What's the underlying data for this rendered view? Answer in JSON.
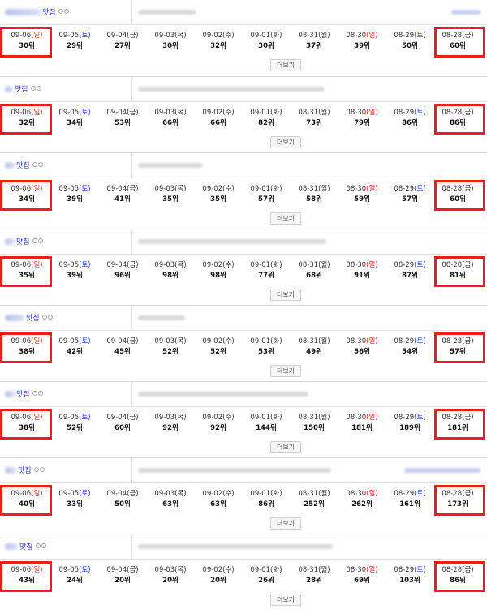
{
  "more_label": "더보기",
  "category_label": "맛집",
  "blocks": [
    {
      "ranks": [
        "30위",
        "29위",
        "27위",
        "30위",
        "32위",
        "30위",
        "37위",
        "39위",
        "50위",
        "60위"
      ]
    },
    {
      "ranks": [
        "32위",
        "34위",
        "53위",
        "66위",
        "66위",
        "82위",
        "73위",
        "79위",
        "86위",
        "86위"
      ]
    },
    {
      "ranks": [
        "34위",
        "39위",
        "41위",
        "35위",
        "35위",
        "57위",
        "58위",
        "59위",
        "57위",
        "60위"
      ]
    },
    {
      "ranks": [
        "35위",
        "39위",
        "96위",
        "98위",
        "98위",
        "77위",
        "68위",
        "91위",
        "87위",
        "81위"
      ]
    },
    {
      "ranks": [
        "38위",
        "42위",
        "45위",
        "52위",
        "52위",
        "53위",
        "49위",
        "56위",
        "54위",
        "57위"
      ]
    },
    {
      "ranks": [
        "38위",
        "52위",
        "60위",
        "92위",
        "92위",
        "144위",
        "150위",
        "181위",
        "189위",
        "181위"
      ]
    },
    {
      "ranks": [
        "40위",
        "33위",
        "50위",
        "63위",
        "63위",
        "86위",
        "252위",
        "262위",
        "161위",
        "173위"
      ]
    },
    {
      "ranks": [
        "43위",
        "24위",
        "20위",
        "20위",
        "20위",
        "26위",
        "28위",
        "69위",
        "103위",
        "86위"
      ]
    }
  ],
  "dates": [
    {
      "day": "09-06",
      "dow": "(일)",
      "type": "sun"
    },
    {
      "day": "09-05",
      "dow": "(토)",
      "type": "sat"
    },
    {
      "day": "09-04",
      "dow": "(금)",
      "type": ""
    },
    {
      "day": "09-03",
      "dow": "(목)",
      "type": ""
    },
    {
      "day": "09-02",
      "dow": "(수)",
      "type": ""
    },
    {
      "day": "09-01",
      "dow": "(화)",
      "type": ""
    },
    {
      "day": "08-31",
      "dow": "(월)",
      "type": ""
    },
    {
      "day": "08-30",
      "dow": "(일)",
      "type": "sun"
    },
    {
      "day": "08-29",
      "dow": "(토)",
      "type": "sat"
    },
    {
      "day": "08-28",
      "dow": "(금)",
      "type": ""
    }
  ],
  "colors": {
    "highlight": "#ef1c1c",
    "sunday": "#e0241a",
    "saturday": "#2b3fd0"
  }
}
